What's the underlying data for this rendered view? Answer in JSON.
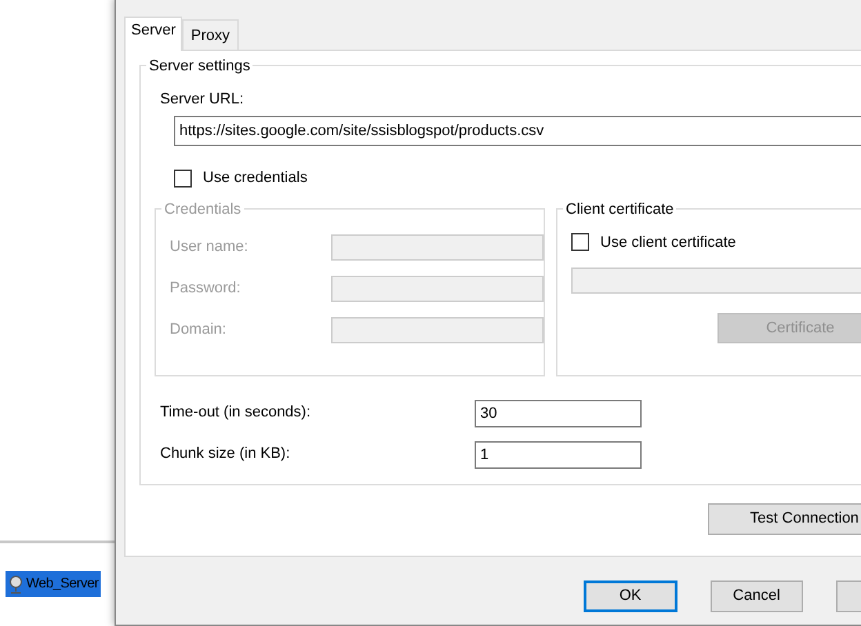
{
  "background": {
    "selected_item": {
      "label": "Web_Server",
      "selected": true
    }
  },
  "dialog": {
    "tabs": [
      {
        "label": "Server",
        "selected": true
      },
      {
        "label": "Proxy",
        "selected": false
      }
    ],
    "server_settings": {
      "title": "Server settings",
      "url_label": "Server URL:",
      "url_value": "https://sites.google.com/site/ssisblogspot/products.csv",
      "use_credentials": {
        "label": "Use credentials",
        "checked": false
      },
      "credentials": {
        "title": "Credentials",
        "disabled": true,
        "fields": [
          {
            "label": "User name:"
          },
          {
            "label": "Password:"
          },
          {
            "label": "Domain:"
          }
        ]
      },
      "client_certificate": {
        "title": "Client certificate",
        "use": {
          "label": "Use client certificate",
          "checked": false
        },
        "button": {
          "label": "Certificate",
          "disabled": true
        }
      },
      "timeout": {
        "label": "Time-out (in seconds):",
        "value": "30"
      },
      "chunk": {
        "label": "Chunk size (in KB):",
        "value": "1"
      }
    },
    "test_button": "Test Connection",
    "buttons": [
      {
        "label": "OK",
        "default": true
      },
      {
        "label": "Cancel",
        "default": false
      }
    ]
  }
}
